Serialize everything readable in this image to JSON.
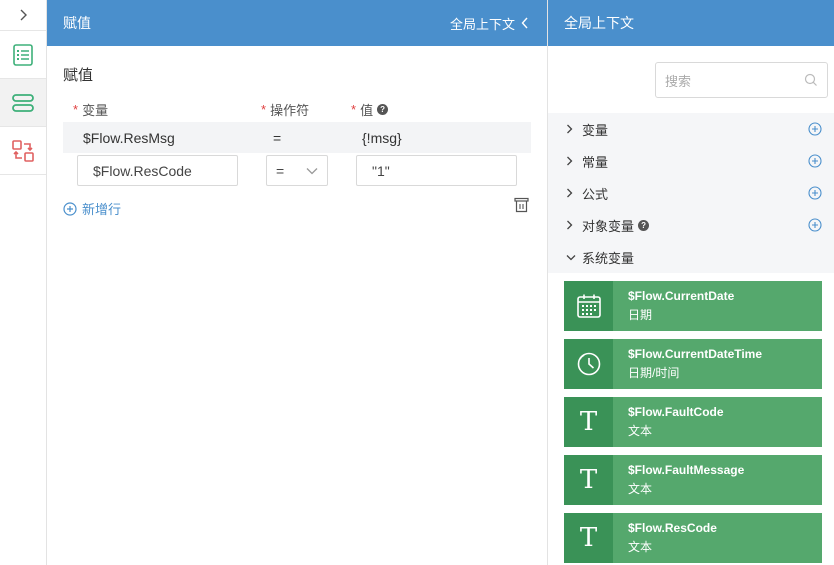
{
  "assign": {
    "header_title": "赋值",
    "context_link": "全局上下文",
    "section_title": "赋值",
    "columns": {
      "variable": "变量",
      "operator": "操作符",
      "value": "值",
      "required_mark": "*"
    },
    "rows": [
      {
        "variable": "$Flow.ResMsg",
        "operator": "=",
        "value": "{!msg}"
      },
      {
        "variable": "$Flow.ResCode",
        "operator": "=",
        "value": "\"1\""
      }
    ],
    "add_row_label": "新增行"
  },
  "context": {
    "header_title": "全局上下文",
    "search_placeholder": "搜索",
    "tree": [
      {
        "label": "变量",
        "expanded": false
      },
      {
        "label": "常量",
        "expanded": false
      },
      {
        "label": "公式",
        "expanded": false
      },
      {
        "label": "对象变量",
        "expanded": false
      },
      {
        "label": "系统变量",
        "expanded": true
      }
    ],
    "system_vars": [
      {
        "name": "$Flow.CurrentDate",
        "type": "日期",
        "icon": "calendar-icon"
      },
      {
        "name": "$Flow.CurrentDateTime",
        "type": "日期/时间",
        "icon": "clock-icon"
      },
      {
        "name": "$Flow.FaultCode",
        "type": "文本",
        "icon": "text-icon"
      },
      {
        "name": "$Flow.FaultMessage",
        "type": "文本",
        "icon": "text-icon"
      },
      {
        "name": "$Flow.ResCode",
        "type": "文本",
        "icon": "text-icon"
      }
    ]
  },
  "icons": {
    "text_glyph": "T",
    "help_glyph": "?"
  },
  "colors": {
    "header": "#4a8fcc",
    "card": "#55a86d",
    "card_icon_bg": "#3a9257",
    "accent": "#4a8fcc",
    "required": "#e04040"
  }
}
